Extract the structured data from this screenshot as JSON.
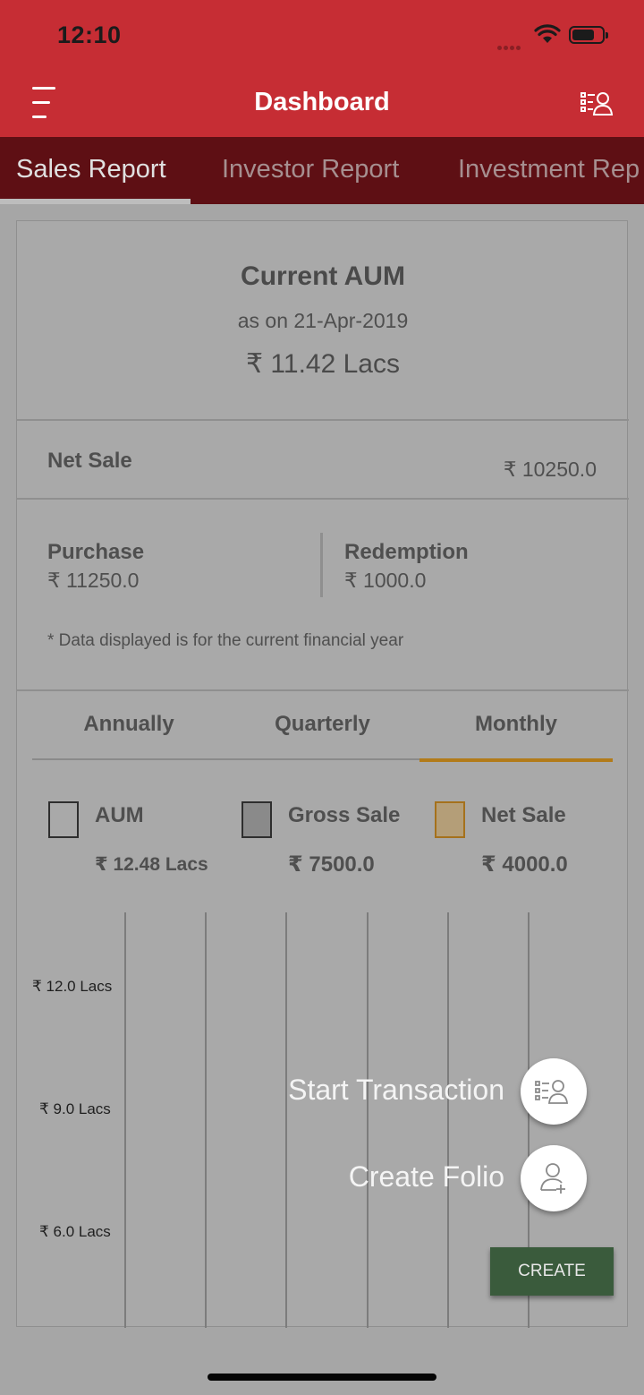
{
  "status": {
    "time": "12:10"
  },
  "appbar": {
    "title": "Dashboard"
  },
  "tabs": [
    {
      "label": "Sales Report",
      "active": true
    },
    {
      "label": "Investor Report",
      "active": false
    },
    {
      "label": "Investment Rep",
      "active": false
    }
  ],
  "aum": {
    "title": "Current AUM",
    "date": "as on 21-Apr-2019",
    "value": "₹ 11.42 Lacs"
  },
  "net_sale": {
    "label": "Net Sale",
    "value": "₹ 10250.0"
  },
  "purchase": {
    "label": "Purchase",
    "value": "₹ 11250.0"
  },
  "redemption": {
    "label": "Redemption",
    "value": "₹ 1000.0"
  },
  "note": "* Data displayed is for the current financial year",
  "period_tabs": [
    {
      "label": "Annually",
      "active": false
    },
    {
      "label": "Quarterly",
      "active": false
    },
    {
      "label": "Monthly",
      "active": true
    }
  ],
  "legend": [
    {
      "name": "AUM",
      "value": "₹ 12.48 Lacs",
      "color": "#a9a9a9"
    },
    {
      "name": "Gross Sale",
      "value": "₹ 7500.0",
      "color": "#8a8a8a"
    },
    {
      "name": "Net Sale",
      "value": "₹ 4000.0",
      "color": "#b49e78"
    }
  ],
  "chart_data": {
    "type": "bar",
    "y_tick_labels": [
      "₹ 12.0 Lacs",
      "₹ 9.0 Lacs",
      "₹ 6.0 Lacs"
    ],
    "grid": true
  },
  "fab_menu": {
    "start_transaction": "Start Transaction",
    "create_folio": "Create Folio",
    "create_button": "CREATE"
  },
  "colors": {
    "header_red": "#c62d34",
    "tab_dark": "#5e0f14",
    "accent_gold": "#b27b1a",
    "create_green": "#3a5b3c"
  }
}
